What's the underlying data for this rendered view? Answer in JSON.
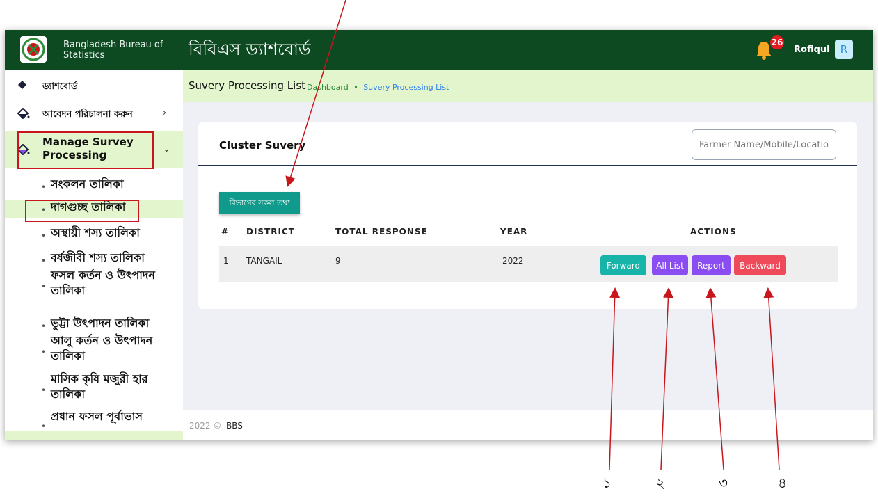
{
  "header": {
    "org_name": "Bangladesh Bureau of Statistics",
    "page_heading": "বিবিএস ড্যাশবোর্ড",
    "notification_count": "26",
    "user_name": "Rofiqul",
    "avatar_initial": "R"
  },
  "sidebar": {
    "items": [
      {
        "label": "ড্যাশবোর্ড"
      },
      {
        "label": "আবেদন পরিচালনা করুন"
      },
      {
        "label": "Manage Survey Processing"
      }
    ],
    "sub_items": [
      {
        "label": "সংকলন তালিকা"
      },
      {
        "label": "দাগগুচ্ছ তালিকা"
      },
      {
        "label": "অস্থায়ী শস্য তালিকা"
      },
      {
        "label": "বর্ষজীবী শস্য তালিকা"
      },
      {
        "label": "ফসল কর্তন ও উৎপাদন তালিকা"
      },
      {
        "label": "ভুট্টা উৎপাদন তালিকা"
      },
      {
        "label": "আলু কর্তন ও উৎপাদন তালিকা"
      },
      {
        "label": "মাসিক কৃষি মজুরী হার তালিকা"
      },
      {
        "label": "প্রধান ফসল পূর্বাভাস"
      }
    ]
  },
  "breadcrumb": {
    "title": "Suvery Processing List",
    "crumb_1": "Dashboard",
    "separator": "•",
    "crumb_2": "Suvery Processing List"
  },
  "card": {
    "title": "Cluster Suvery",
    "search_placeholder": "Farmer Name/Mobile/Location",
    "all_info_button": "বিভাগের সকল তথ্য",
    "table": {
      "headers": [
        "#",
        "DISTRICT",
        "TOTAL RESPONSE",
        "YEAR",
        "ACTIONS"
      ],
      "rows": [
        {
          "index": "1",
          "district": "TANGAIL",
          "total_response": "9",
          "year": "2022"
        }
      ],
      "actions": [
        "Forward",
        "All List",
        "Report",
        "Backward"
      ]
    }
  },
  "footer": {
    "year": "2022 ©",
    "brand": "BBS"
  },
  "callouts": [
    "১",
    "২",
    "৩",
    "৪"
  ],
  "colors": {
    "header_bg": "#0d4a22",
    "highlight_bg": "#e3f5cc",
    "forward": "#17b5a9",
    "all_list": "#8a4df2",
    "report": "#8a4df2",
    "backward": "#ee4a5a",
    "annotation": "#c8161d"
  }
}
